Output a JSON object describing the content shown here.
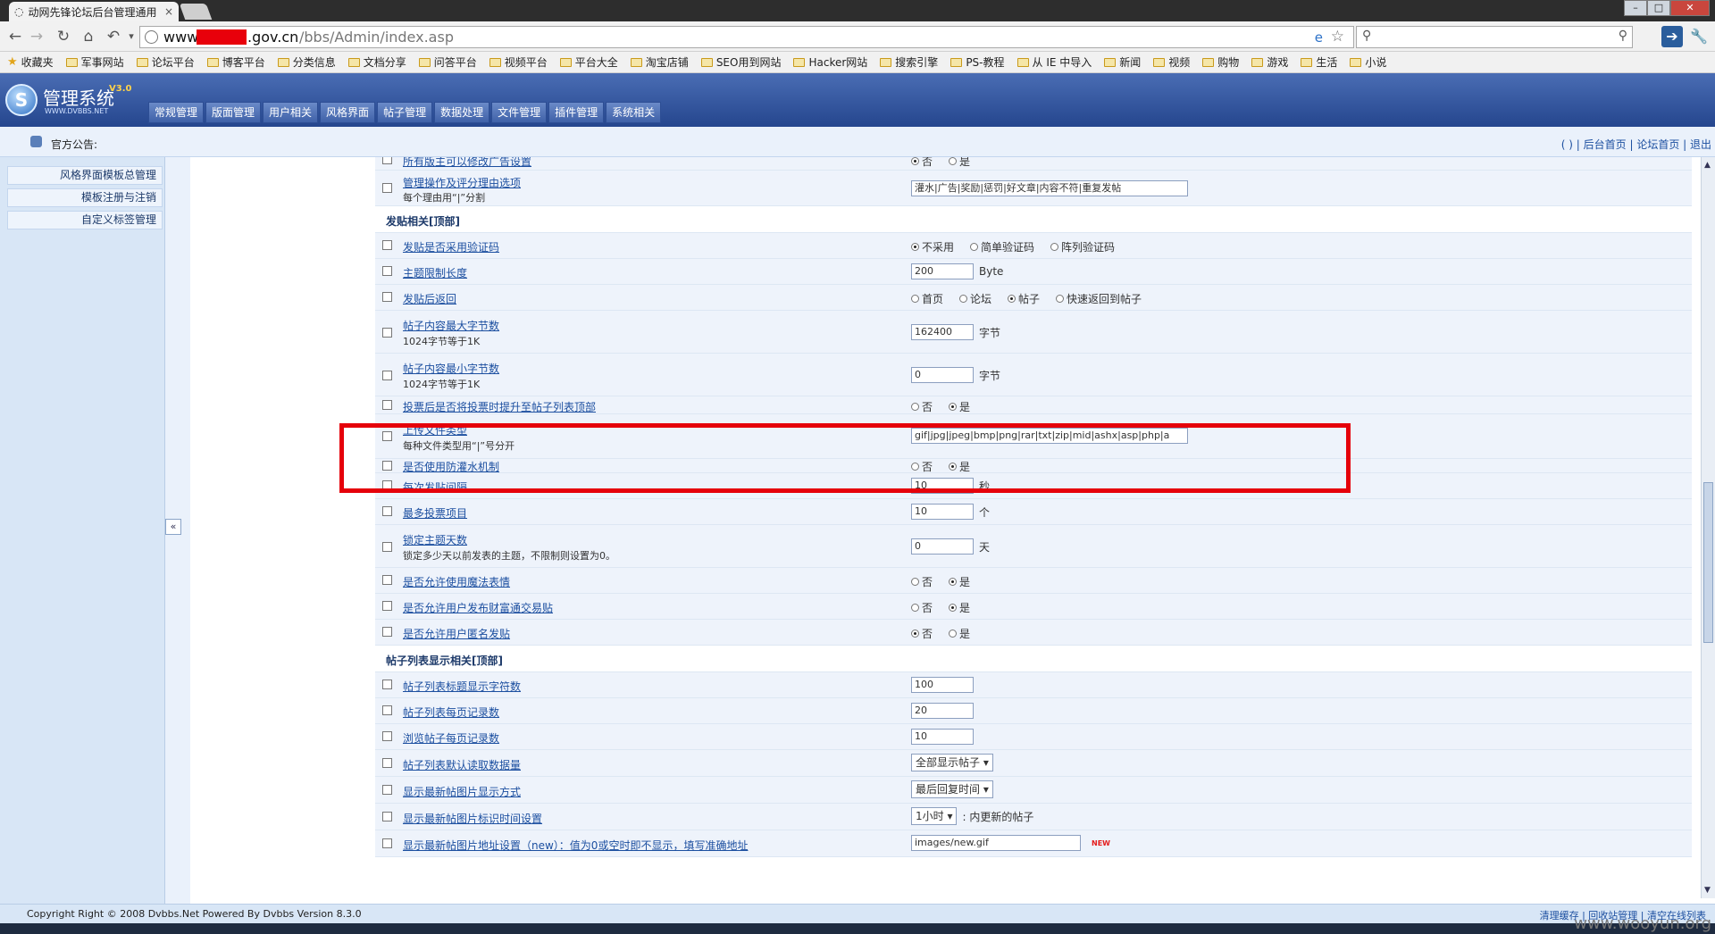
{
  "browser": {
    "tab_title": "动网先锋论坛后台管理通用",
    "url_prefix": "www.",
    "url_domain": ".gov.cn",
    "url_path": "/bbs/Admin/index.asp"
  },
  "bookmarks": [
    "收藏夹",
    "军事网站",
    "论坛平台",
    "博客平台",
    "分类信息",
    "文档分享",
    "问答平台",
    "视频平台",
    "平台大全",
    "淘宝店铺",
    "SEO用到网站",
    "Hacker网站",
    "搜索引擎",
    "PS-教程",
    "从 IE 中导入",
    "新闻",
    "视频",
    "购物",
    "游戏",
    "生活",
    "小说"
  ],
  "header": {
    "logo_text": "S",
    "system_name": "管理系统",
    "version": "V3.0",
    "site": "WWW.DVBBS.NET",
    "menu": [
      "常规管理",
      "版面管理",
      "用户相关",
      "风格界面",
      "帖子管理",
      "数据处理",
      "文件管理",
      "插件管理",
      "系统相关"
    ]
  },
  "notice": {
    "label": "官方公告:",
    "links": "( ) | 后台首页 | 论坛首页 | 退出"
  },
  "sidebar": {
    "items": [
      "风格界面模板总管理",
      "模板注册与注销",
      "自定义标签管理"
    ],
    "collapse": "«"
  },
  "settings": {
    "r0": {
      "label": "所有版主可以修改广告设置",
      "opts": [
        "否",
        "是"
      ]
    },
    "r1": {
      "label": "管理操作及评分理由选项",
      "hint": "每个理由用“|”分割",
      "value": "灌水|广告|奖励|惩罚|好文章|内容不符|重复发帖"
    },
    "sec1": {
      "title": "发贴相关[顶部]"
    },
    "r2": {
      "label": "发贴是否采用验证码",
      "opts": [
        "不采用",
        "简单验证码",
        "阵列验证码"
      ]
    },
    "r3": {
      "label": "主题限制长度",
      "value": "200",
      "unit": "Byte"
    },
    "r4": {
      "label": "发贴后返回",
      "opts": [
        "首页",
        "论坛",
        "帖子",
        "快速返回到帖子"
      ]
    },
    "r5": {
      "label": "帖子内容最大字节数",
      "hint": "1024字节等于1K",
      "value": "162400",
      "unit": "字节"
    },
    "r6": {
      "label": "帖子内容最小字节数",
      "hint": "1024字节等于1K",
      "value": "0",
      "unit": "字节"
    },
    "r7": {
      "label": "投票后是否将投票时提升至帖子列表顶部",
      "opts": [
        "否",
        "是"
      ]
    },
    "r8": {
      "label": "上传文件类型",
      "hint": "每种文件类型用“|”号分开",
      "value": "gif|jpg|jpeg|bmp|png|rar|txt|zip|mid|ashx|asp|php|a"
    },
    "r9": {
      "label": "是否使用防灌水机制",
      "opts": [
        "否",
        "是"
      ]
    },
    "r10": {
      "label": "每次发贴间隔",
      "value": "10",
      "unit": "秒"
    },
    "r11": {
      "label": "最多投票项目",
      "value": "10",
      "unit": "个"
    },
    "r12": {
      "label": "锁定主题天数",
      "hint": "锁定多少天以前发表的主题，不限制则设置为0。",
      "value": "0",
      "unit": "天"
    },
    "r13": {
      "label": "是否允许使用魔法表情",
      "opts": [
        "否",
        "是"
      ]
    },
    "r14": {
      "label": "是否允许用户发布财富通交易贴",
      "opts": [
        "否",
        "是"
      ]
    },
    "r15": {
      "label": "是否允许用户匿名发贴",
      "opts": [
        "否",
        "是"
      ]
    },
    "sec2": {
      "title": "帖子列表显示相关[顶部]"
    },
    "r16": {
      "label": "帖子列表标题显示字符数",
      "value": "100"
    },
    "r17": {
      "label": "帖子列表每页记录数",
      "value": "20"
    },
    "r18": {
      "label": "浏览帖子每页记录数",
      "value": "10"
    },
    "r19": {
      "label": "帖子列表默认读取数据量",
      "value": "全部显示帖子"
    },
    "r20": {
      "label": "显示最新帖图片显示方式",
      "value": "最后回复时间"
    },
    "r21": {
      "label": "显示最新帖图片标识时间设置",
      "value": "1小时",
      "unit": ": 内更新的帖子"
    },
    "r22": {
      "label": "显示最新帖图片地址设置（new）：值为0或空时即不显示，填写准确地址",
      "value": "images/new.gif",
      "badge": "NEW"
    }
  },
  "footer": {
    "copyright": "Copyright Right © 2008 Dvbbs.Net Powered By Dvbbs Version 8.3.0",
    "links": "清理缓存 | 回收站管理 | 清空在线列表"
  },
  "watermark": "www.wooyun.org",
  "colors": {
    "highlight": "#e5000a",
    "header": "#25468e",
    "link": "#1c4fa0"
  }
}
